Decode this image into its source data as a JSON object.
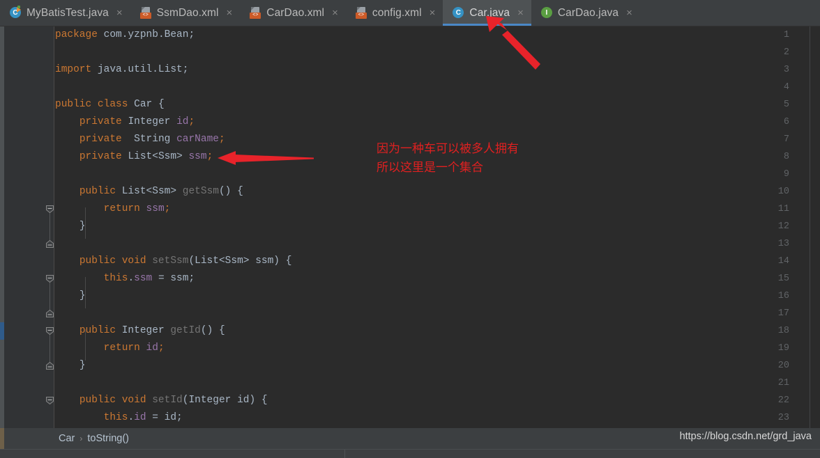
{
  "window": {
    "background": "#3c3f41",
    "editor_background": "#2b2b2b",
    "gutter_background": "#313335",
    "accent": "#4a88c7",
    "annotation_color": "#e02020"
  },
  "tabs": [
    {
      "label": "MyBatisTest.java",
      "icon": "java-test-class-icon",
      "icon_letter": "C",
      "active": false,
      "close_label": "×"
    },
    {
      "label": "SsmDao.xml",
      "icon": "xml-file-icon",
      "icon_letter": "<>",
      "active": false,
      "close_label": "×"
    },
    {
      "label": "CarDao.xml",
      "icon": "xml-file-icon",
      "icon_letter": "<>",
      "active": false,
      "close_label": "×"
    },
    {
      "label": "config.xml",
      "icon": "xml-file-icon",
      "icon_letter": "<>",
      "active": false,
      "close_label": "×"
    },
    {
      "label": "Car.java",
      "icon": "java-class-icon",
      "icon_letter": "C",
      "active": true,
      "close_label": "×"
    },
    {
      "label": "CarDao.java",
      "icon": "java-interface-icon",
      "icon_letter": "I",
      "active": false,
      "close_label": "×"
    }
  ],
  "editor": {
    "language": "java",
    "first_line": 1,
    "last_line": 23,
    "caret_line": 18,
    "line_numbers": [
      1,
      2,
      3,
      4,
      5,
      6,
      7,
      8,
      9,
      10,
      11,
      12,
      13,
      14,
      15,
      16,
      17,
      18,
      19,
      20,
      21,
      22,
      23
    ],
    "lines": [
      {
        "n": 1,
        "text": "package com.yzpnb.Bean;"
      },
      {
        "n": 2,
        "text": ""
      },
      {
        "n": 3,
        "text": "import java.util.List;"
      },
      {
        "n": 4,
        "text": ""
      },
      {
        "n": 5,
        "text": "public class Car {"
      },
      {
        "n": 6,
        "text": "    private Integer id;"
      },
      {
        "n": 7,
        "text": "    private  String carName;"
      },
      {
        "n": 8,
        "text": "    private List<Ssm> ssm;"
      },
      {
        "n": 9,
        "text": ""
      },
      {
        "n": 10,
        "text": "    public List<Ssm> getSsm() {"
      },
      {
        "n": 11,
        "text": "        return ssm;"
      },
      {
        "n": 12,
        "text": "    }"
      },
      {
        "n": 13,
        "text": ""
      },
      {
        "n": 14,
        "text": "    public void setSsm(List<Ssm> ssm) {"
      },
      {
        "n": 15,
        "text": "        this.ssm = ssm;"
      },
      {
        "n": 16,
        "text": "    }"
      },
      {
        "n": 17,
        "text": ""
      },
      {
        "n": 18,
        "text": "    public Integer getId() {"
      },
      {
        "n": 19,
        "text": "        return id;"
      },
      {
        "n": 20,
        "text": "    }"
      },
      {
        "n": 21,
        "text": ""
      },
      {
        "n": 22,
        "text": "    public void setId(Integer id) {"
      },
      {
        "n": 23,
        "text": "        this.id = id;"
      }
    ],
    "fold_markers": [
      {
        "line": 10,
        "type": "expanded-start"
      },
      {
        "line": 12,
        "type": "expanded-end"
      },
      {
        "line": 14,
        "type": "expanded-start"
      },
      {
        "line": 16,
        "type": "expanded-end"
      },
      {
        "line": 18,
        "type": "expanded-start"
      },
      {
        "line": 20,
        "type": "expanded-end"
      },
      {
        "line": 22,
        "type": "expanded-start"
      }
    ]
  },
  "annotation": {
    "line1": "因为一种车可以被多人拥有",
    "line2": "所以这里是一个集合",
    "arrows": [
      {
        "name": "arrow-to-car-tab",
        "direction": "up-left"
      },
      {
        "name": "arrow-to-ssm-field",
        "direction": "left"
      }
    ]
  },
  "breadcrumb": {
    "items": [
      "Car",
      "toString()"
    ],
    "separator": "›"
  },
  "watermark": {
    "text": "https://blog.csdn.net/grd_java"
  }
}
